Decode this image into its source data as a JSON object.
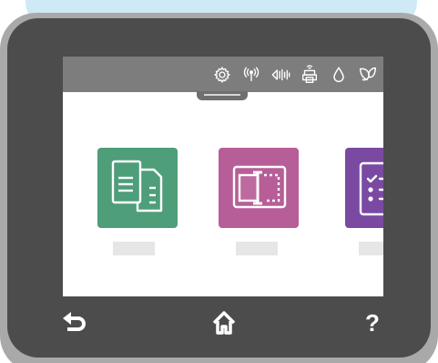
{
  "device": {
    "bezel_color": "#4c4c4c",
    "frame_color": "#a9a9a9",
    "screen_bg": "#ffffff"
  },
  "status_bar": {
    "bg": "#7d7d7d",
    "icons": [
      "settings-gear-icon",
      "wireless-antenna-icon",
      "speaker-volume-icon",
      "remote-print-icon",
      "ink-drop-icon",
      "eco-leaf-icon"
    ]
  },
  "apps": [
    {
      "id": "copy",
      "icon": "copy-documents-icon",
      "color": "#4e9e79",
      "label": ""
    },
    {
      "id": "scan",
      "icon": "scan-frame-icon",
      "color": "#b75e98",
      "label": ""
    },
    {
      "id": "forms",
      "icon": "checklist-icon",
      "color": "#7a4aa2",
      "label": ""
    }
  ],
  "nav": {
    "back_icon": "back-arrow-icon",
    "home_icon": "home-icon",
    "help_label": "?"
  }
}
